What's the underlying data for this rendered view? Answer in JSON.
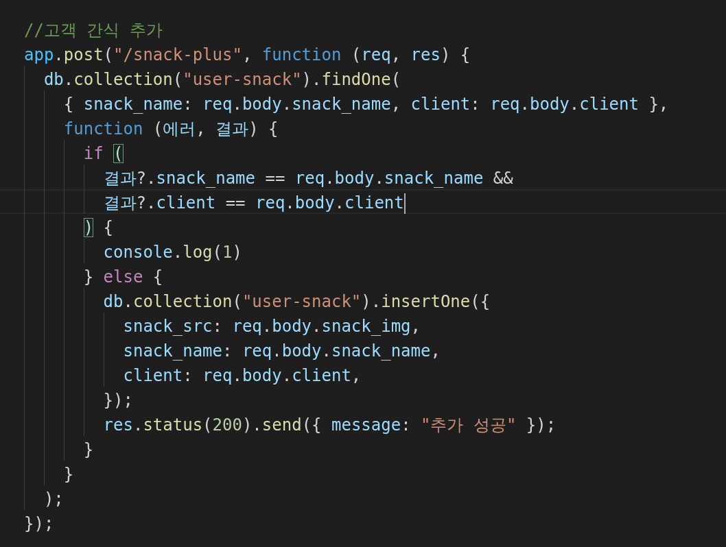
{
  "editor": {
    "lines": [
      {
        "current": false,
        "tokens": [
          {
            "kind": "comment",
            "text": "//고객 간식 추가"
          }
        ]
      },
      {
        "current": false,
        "tokens": [
          {
            "kind": "const",
            "text": "app"
          },
          {
            "kind": "punc",
            "text": "."
          },
          {
            "kind": "fn",
            "text": "post"
          },
          {
            "kind": "punc",
            "text": "("
          },
          {
            "kind": "str",
            "text": "\"/snack-plus\""
          },
          {
            "kind": "punc",
            "text": ", "
          },
          {
            "kind": "keyword",
            "text": "function"
          },
          {
            "kind": "punc",
            "text": " ("
          },
          {
            "kind": "var",
            "text": "req"
          },
          {
            "kind": "punc",
            "text": ", "
          },
          {
            "kind": "var",
            "text": "res"
          },
          {
            "kind": "punc",
            "text": ") {"
          }
        ]
      },
      {
        "current": false,
        "tokens": [
          {
            "kind": "var",
            "text": "  db"
          },
          {
            "kind": "punc",
            "text": "."
          },
          {
            "kind": "fn",
            "text": "collection"
          },
          {
            "kind": "punc",
            "text": "("
          },
          {
            "kind": "str",
            "text": "\"user-snack\""
          },
          {
            "kind": "punc",
            "text": ")."
          },
          {
            "kind": "fn",
            "text": "findOne"
          },
          {
            "kind": "punc",
            "text": "("
          }
        ]
      },
      {
        "current": false,
        "tokens": [
          {
            "kind": "punc",
            "text": "    { "
          },
          {
            "kind": "var",
            "text": "snack_name"
          },
          {
            "kind": "punc",
            "text": ": "
          },
          {
            "kind": "var",
            "text": "req"
          },
          {
            "kind": "punc",
            "text": "."
          },
          {
            "kind": "var",
            "text": "body"
          },
          {
            "kind": "punc",
            "text": "."
          },
          {
            "kind": "var",
            "text": "snack_name"
          },
          {
            "kind": "punc",
            "text": ", "
          },
          {
            "kind": "var",
            "text": "client"
          },
          {
            "kind": "punc",
            "text": ": "
          },
          {
            "kind": "var",
            "text": "req"
          },
          {
            "kind": "punc",
            "text": "."
          },
          {
            "kind": "var",
            "text": "body"
          },
          {
            "kind": "punc",
            "text": "."
          },
          {
            "kind": "var",
            "text": "client"
          },
          {
            "kind": "punc",
            "text": " },"
          }
        ]
      },
      {
        "current": false,
        "tokens": [
          {
            "kind": "keyword",
            "text": "    function"
          },
          {
            "kind": "punc",
            "text": " ("
          },
          {
            "kind": "param",
            "text": "에러"
          },
          {
            "kind": "punc",
            "text": ", "
          },
          {
            "kind": "var",
            "text": "결과"
          },
          {
            "kind": "punc",
            "text": ") {"
          }
        ]
      },
      {
        "current": false,
        "tokens": [
          {
            "kind": "control",
            "text": "      if "
          },
          {
            "kind": "bracket_match",
            "text": "("
          }
        ]
      },
      {
        "current": false,
        "tokens": [
          {
            "kind": "var",
            "text": "        결과"
          },
          {
            "kind": "punc",
            "text": "?."
          },
          {
            "kind": "var",
            "text": "snack_name"
          },
          {
            "kind": "punc",
            "text": " == "
          },
          {
            "kind": "var",
            "text": "req"
          },
          {
            "kind": "punc",
            "text": "."
          },
          {
            "kind": "var",
            "text": "body"
          },
          {
            "kind": "punc",
            "text": "."
          },
          {
            "kind": "var",
            "text": "snack_name"
          },
          {
            "kind": "punc",
            "text": " &&"
          }
        ]
      },
      {
        "current": true,
        "tokens": [
          {
            "kind": "var",
            "text": "        결과"
          },
          {
            "kind": "punc",
            "text": "?."
          },
          {
            "kind": "var",
            "text": "client"
          },
          {
            "kind": "punc",
            "text": " == "
          },
          {
            "kind": "var",
            "text": "req"
          },
          {
            "kind": "punc",
            "text": "."
          },
          {
            "kind": "var",
            "text": "body"
          },
          {
            "kind": "punc",
            "text": "."
          },
          {
            "kind": "var",
            "text": "client"
          }
        ]
      },
      {
        "current": false,
        "tokens": [
          {
            "kind": "bracket_match",
            "text": "      )"
          },
          {
            "kind": "punc",
            "text": " {"
          }
        ]
      },
      {
        "current": false,
        "tokens": [
          {
            "kind": "var",
            "text": "        console"
          },
          {
            "kind": "punc",
            "text": "."
          },
          {
            "kind": "fn",
            "text": "log"
          },
          {
            "kind": "punc",
            "text": "("
          },
          {
            "kind": "num",
            "text": "1"
          },
          {
            "kind": "punc",
            "text": ")"
          }
        ]
      },
      {
        "current": false,
        "tokens": [
          {
            "kind": "punc",
            "text": "      } "
          },
          {
            "kind": "control",
            "text": "else"
          },
          {
            "kind": "punc",
            "text": " {"
          }
        ]
      },
      {
        "current": false,
        "tokens": [
          {
            "kind": "var",
            "text": "        db"
          },
          {
            "kind": "punc",
            "text": "."
          },
          {
            "kind": "fn",
            "text": "collection"
          },
          {
            "kind": "punc",
            "text": "("
          },
          {
            "kind": "str",
            "text": "\"user-snack\""
          },
          {
            "kind": "punc",
            "text": ")."
          },
          {
            "kind": "fn",
            "text": "insertOne"
          },
          {
            "kind": "punc",
            "text": "({"
          }
        ]
      },
      {
        "current": false,
        "tokens": [
          {
            "kind": "var",
            "text": "          snack_src"
          },
          {
            "kind": "punc",
            "text": ": "
          },
          {
            "kind": "var",
            "text": "req"
          },
          {
            "kind": "punc",
            "text": "."
          },
          {
            "kind": "var",
            "text": "body"
          },
          {
            "kind": "punc",
            "text": "."
          },
          {
            "kind": "var",
            "text": "snack_img"
          },
          {
            "kind": "punc",
            "text": ","
          }
        ]
      },
      {
        "current": false,
        "tokens": [
          {
            "kind": "var",
            "text": "          snack_name"
          },
          {
            "kind": "punc",
            "text": ": "
          },
          {
            "kind": "var",
            "text": "req"
          },
          {
            "kind": "punc",
            "text": "."
          },
          {
            "kind": "var",
            "text": "body"
          },
          {
            "kind": "punc",
            "text": "."
          },
          {
            "kind": "var",
            "text": "snack_name"
          },
          {
            "kind": "punc",
            "text": ","
          }
        ]
      },
      {
        "current": false,
        "tokens": [
          {
            "kind": "var",
            "text": "          client"
          },
          {
            "kind": "punc",
            "text": ": "
          },
          {
            "kind": "var",
            "text": "req"
          },
          {
            "kind": "punc",
            "text": "."
          },
          {
            "kind": "var",
            "text": "body"
          },
          {
            "kind": "punc",
            "text": "."
          },
          {
            "kind": "var",
            "text": "client"
          },
          {
            "kind": "punc",
            "text": ","
          }
        ]
      },
      {
        "current": false,
        "tokens": [
          {
            "kind": "punc",
            "text": "        });"
          }
        ]
      },
      {
        "current": false,
        "tokens": [
          {
            "kind": "var",
            "text": "        res"
          },
          {
            "kind": "punc",
            "text": "."
          },
          {
            "kind": "fn",
            "text": "status"
          },
          {
            "kind": "punc",
            "text": "("
          },
          {
            "kind": "num",
            "text": "200"
          },
          {
            "kind": "punc",
            "text": ")."
          },
          {
            "kind": "fn",
            "text": "send"
          },
          {
            "kind": "punc",
            "text": "({ "
          },
          {
            "kind": "var",
            "text": "message"
          },
          {
            "kind": "punc",
            "text": ": "
          },
          {
            "kind": "str",
            "text": "\"추가 성공\""
          },
          {
            "kind": "punc",
            "text": " });"
          }
        ]
      },
      {
        "current": false,
        "tokens": [
          {
            "kind": "punc",
            "text": "      }"
          }
        ]
      },
      {
        "current": false,
        "tokens": [
          {
            "kind": "punc",
            "text": "    }"
          }
        ]
      },
      {
        "current": false,
        "tokens": [
          {
            "kind": "punc",
            "text": "  );"
          }
        ]
      },
      {
        "current": false,
        "tokens": [
          {
            "kind": "punc",
            "text": "});"
          }
        ]
      }
    ]
  }
}
